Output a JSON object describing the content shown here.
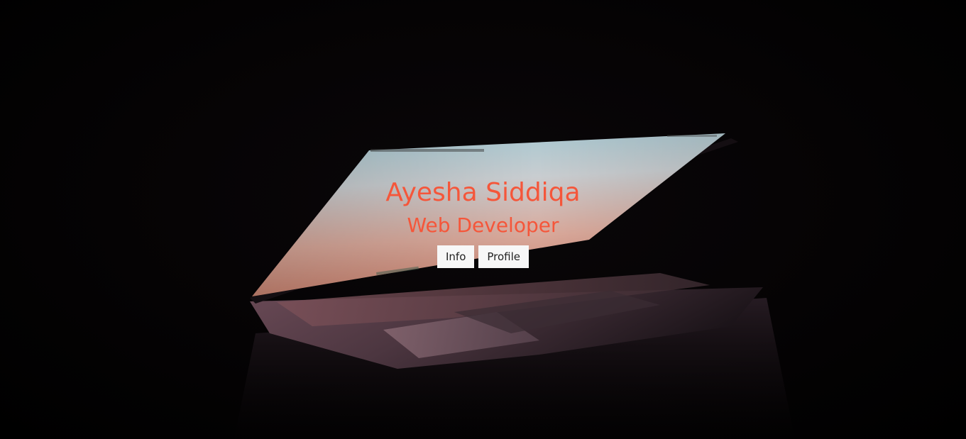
{
  "hero": {
    "name": "Ayesha Siddiqa",
    "title": "Web Developer",
    "buttons": {
      "info": "Info",
      "profile": "Profile"
    },
    "background_image": "laptop-glowing-screen-in-dark"
  },
  "colors": {
    "accent": "#f5563a",
    "button_bg": "#f7f7f7",
    "button_text": "#222222",
    "background": "#000000"
  }
}
